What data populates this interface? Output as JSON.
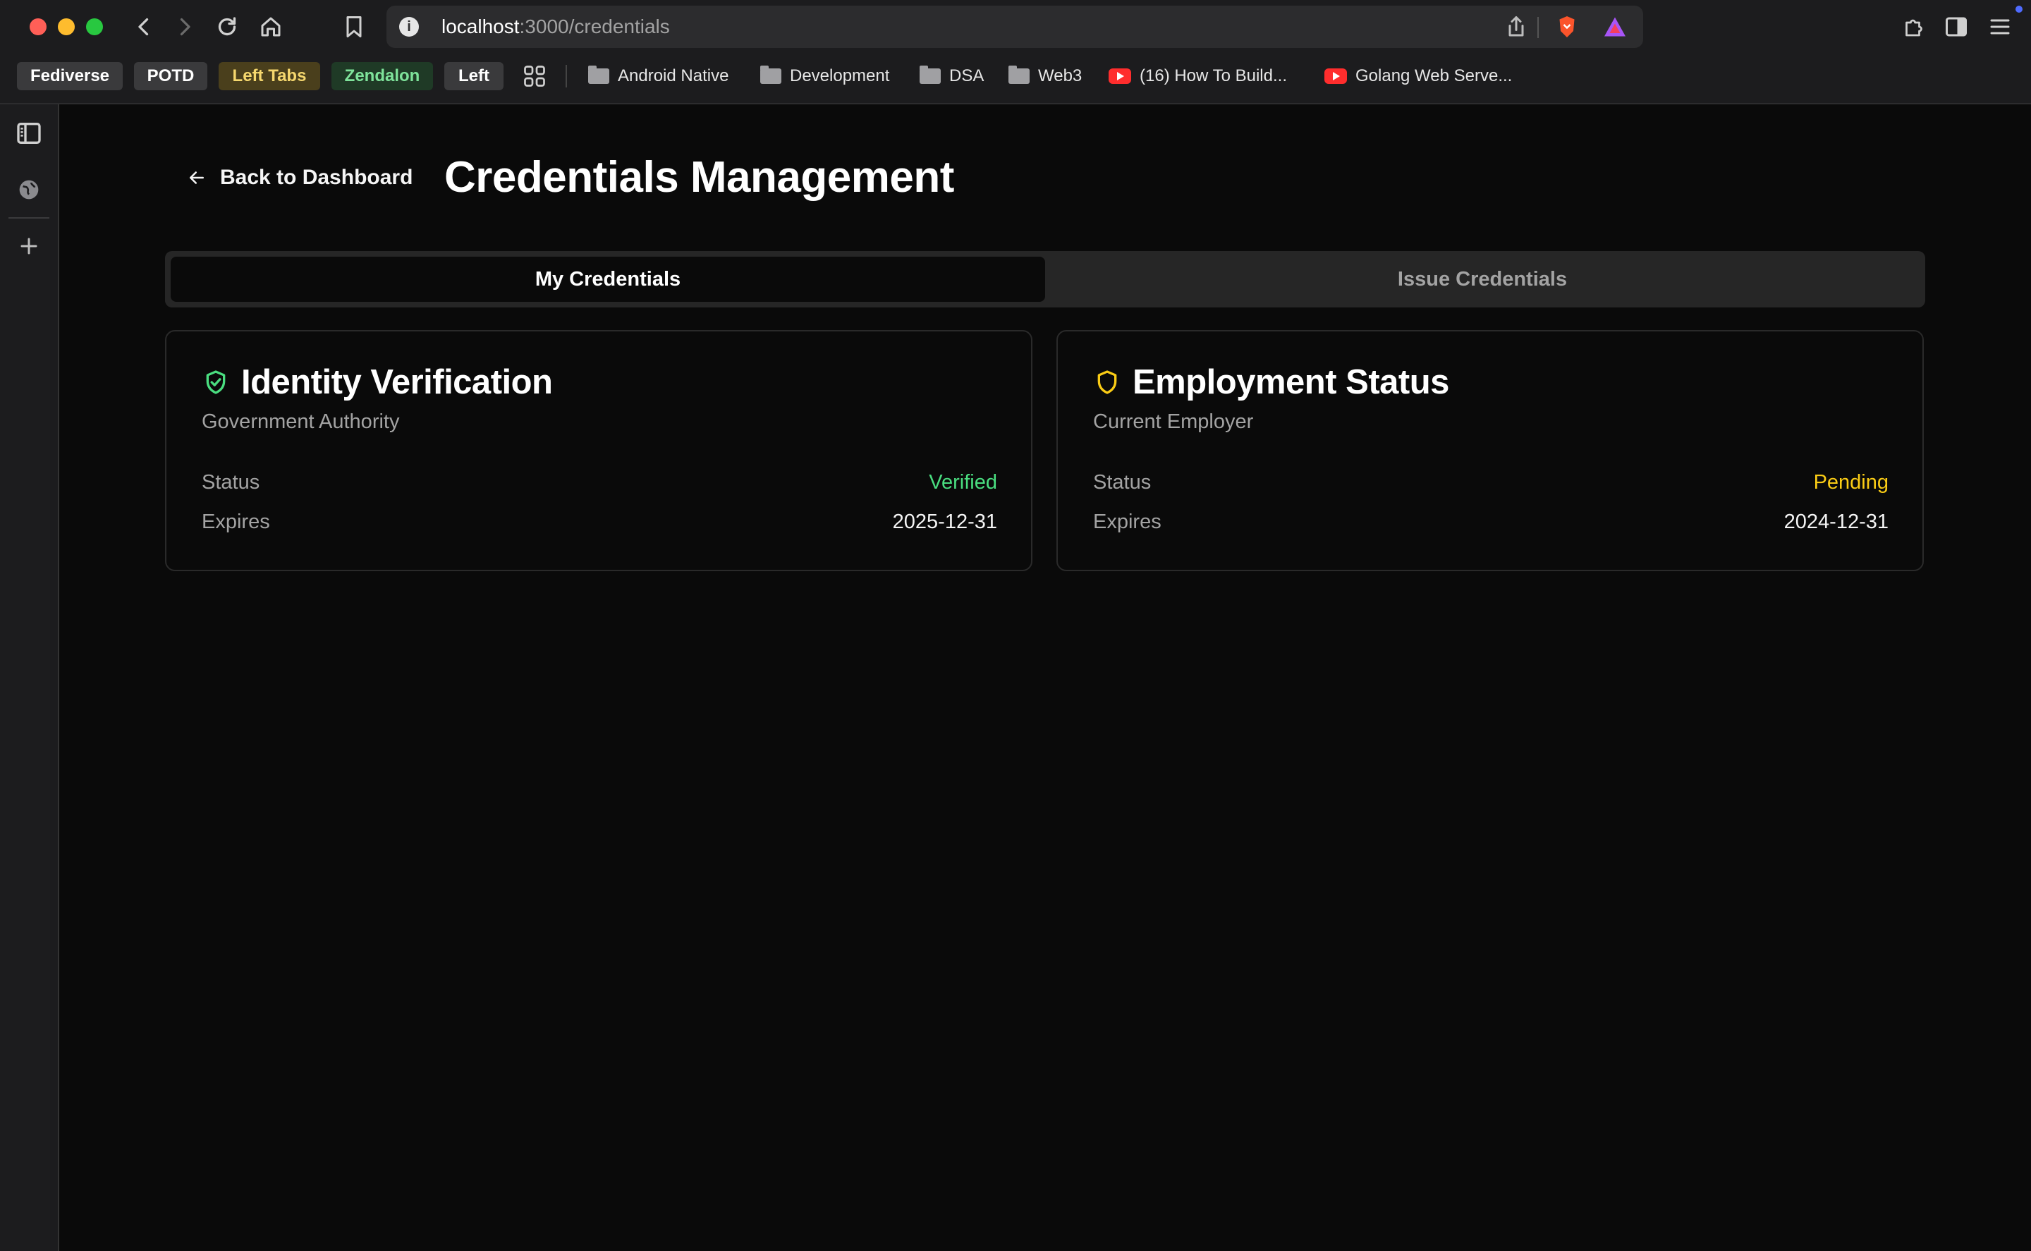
{
  "browser": {
    "url_host": "localhost",
    "url_path": ":3000/credentials",
    "tab_groups": [
      {
        "label": "Fediverse",
        "bg": "#3a3a3c",
        "fg": "#ffffff"
      },
      {
        "label": "POTD",
        "bg": "#3a3a3c",
        "fg": "#ffffff"
      },
      {
        "label": "Left Tabs",
        "bg": "#4a3f1c",
        "fg": "#f5d76e"
      },
      {
        "label": "Zendalon",
        "bg": "#1f3a26",
        "fg": "#7ee29a"
      },
      {
        "label": "Left",
        "bg": "#3a3a3c",
        "fg": "#ffffff"
      }
    ],
    "bookmarks": [
      {
        "label": "Android Native",
        "icon": "folder-icon"
      },
      {
        "label": "Development",
        "icon": "folder-icon"
      },
      {
        "label": "DSA",
        "icon": "folder-icon"
      },
      {
        "label": "Web3",
        "icon": "folder-icon"
      },
      {
        "label": "(16) How To Build...",
        "icon": "youtube-icon"
      },
      {
        "label": "Golang Web Serve...",
        "icon": "youtube-icon"
      }
    ]
  },
  "page": {
    "back_label": "Back to Dashboard",
    "title": "Credentials Management",
    "tabs": [
      {
        "label": "My Credentials",
        "active": true
      },
      {
        "label": "Issue Credentials",
        "active": false
      }
    ],
    "credentials": [
      {
        "title": "Identity Verification",
        "issuer": "Government Authority",
        "status_label": "Status",
        "status": "Verified",
        "status_color": "#4ade80",
        "expires_label": "Expires",
        "expires": "2025-12-31",
        "icon": "shield-check-icon"
      },
      {
        "title": "Employment Status",
        "issuer": "Current Employer",
        "status_label": "Status",
        "status": "Pending",
        "status_color": "#facc15",
        "expires_label": "Expires",
        "expires": "2024-12-31",
        "icon": "shield-icon"
      }
    ]
  },
  "colors": {
    "background": "#0a0a0a",
    "verified": "#4ade80",
    "pending": "#facc15"
  }
}
